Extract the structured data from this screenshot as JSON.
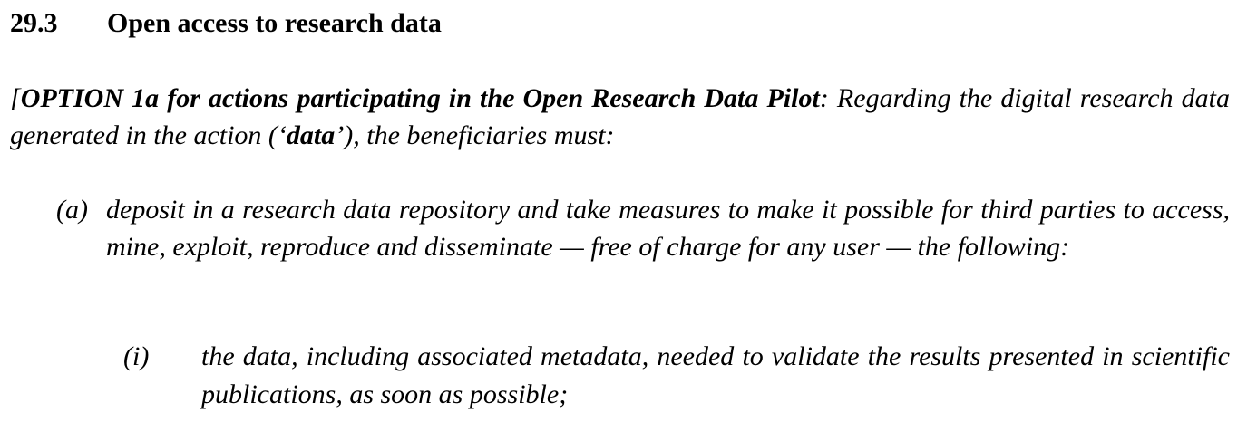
{
  "section": {
    "number": "29.3",
    "title": "Open access to research data"
  },
  "intro": {
    "bracket_open": "[",
    "option_label": "OPTION 1a for actions participating in the Open Research Data Pilot",
    "lead_in": ": Regarding the digital research data generated in the action (‘",
    "defined_term": "data",
    "lead_out": "’), the beneficiaries must:"
  },
  "items": [
    {
      "marker": "(a)",
      "text": "deposit in a research data repository and take measures to make it possible for third parties to access, mine, exploit, reproduce and disseminate — free of charge for any user — the following:"
    }
  ],
  "subitems": [
    {
      "marker": "(i)",
      "text": "the data, including associated metadata, needed to validate the results presented in scientific publications, as soon as possible;"
    }
  ]
}
